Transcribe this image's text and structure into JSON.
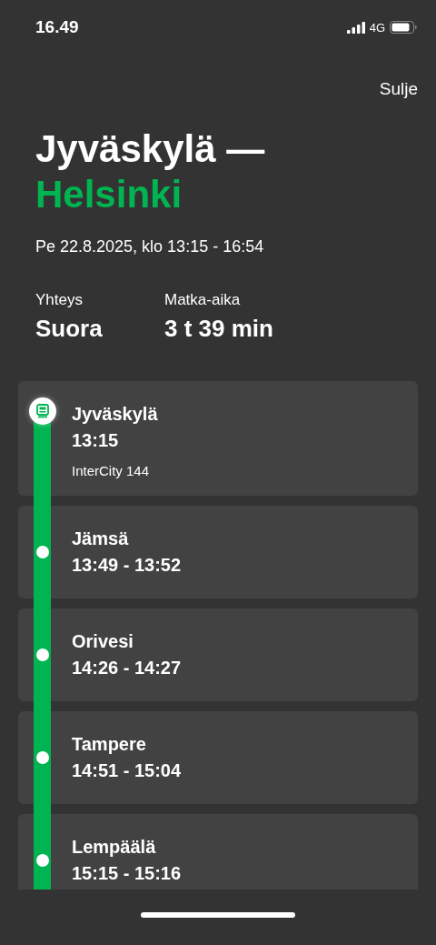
{
  "status_bar": {
    "time": "16.49",
    "network": "4G"
  },
  "close_button": "Sulje",
  "title": {
    "origin": "Jyväskylä —",
    "destination": "Helsinki"
  },
  "date": "Pe 22.8.2025, klo 13:15 - 16:54",
  "summary": [
    {
      "label": "Yhteys",
      "value": "Suora"
    },
    {
      "label": "Matka-aika",
      "value": "3 t 39 min"
    }
  ],
  "stops": [
    {
      "kind": "origin",
      "name": "Jyväskylä",
      "time": "13:15",
      "train": "InterCity 144"
    },
    {
      "kind": "stop",
      "name": "Jämsä",
      "time": "13:49 - 13:52"
    },
    {
      "kind": "stop",
      "name": "Orivesi",
      "time": "14:26 - 14:27"
    },
    {
      "kind": "stop",
      "name": "Tampere",
      "time": "14:51 - 15:04"
    },
    {
      "kind": "stop",
      "name": "Lempäälä",
      "time": "15:15 - 15:16"
    }
  ]
}
